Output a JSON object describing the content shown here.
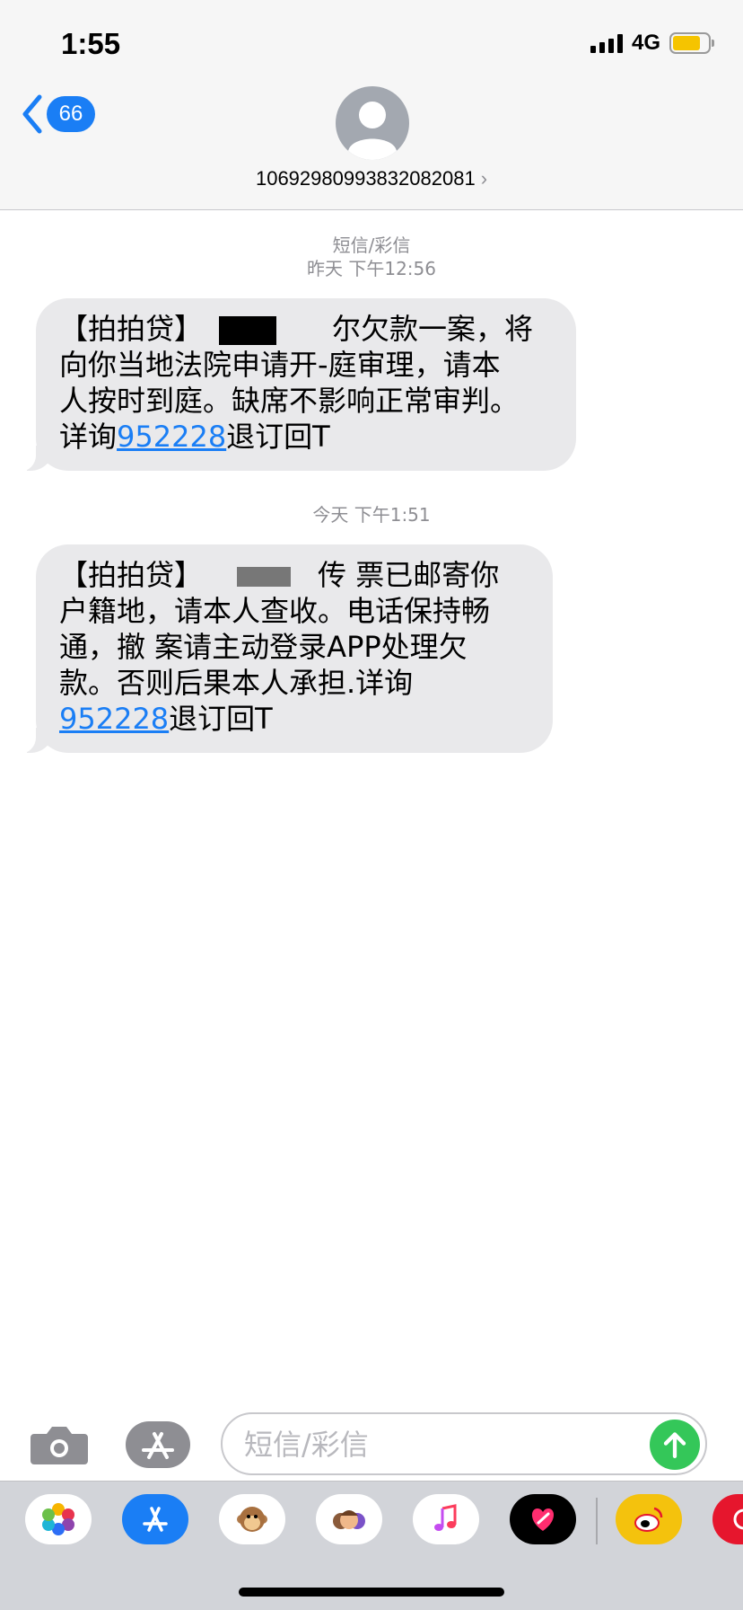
{
  "status": {
    "time": "1:55",
    "network": "4G",
    "battery_level": 0.78
  },
  "nav": {
    "back_count": "66",
    "contact": "106929809938320820​81",
    "chevron": "›"
  },
  "messages": [
    {
      "stamp_line1": "短信/彩信",
      "stamp_line2": "昨天 下午12:56",
      "l1a": "【拍拍贷】",
      "l1b": "尔欠款一案，将",
      "l2a": "向你当地法",
      "l2b": "院申请开-庭审理，请本",
      "l3": "人按时到庭。缺席不影响正常审判。",
      "l4a": "详询",
      "link": "952228",
      "l4b": "退订回T"
    },
    {
      "stamp": "今天 下午1:51",
      "l1a": "【拍拍贷】",
      "l1b": "传 票已邮寄你",
      "l2": "户籍地，请本人查收。电话保持畅",
      "l3": "通，撤 案请主动登录APP处理欠",
      "l4": "款。否则后果本人承担.详询",
      "link": "952228",
      "l5b": "退订回T"
    }
  ],
  "input": {
    "placeholder": "短信/彩信"
  },
  "drawer": {
    "apps": [
      "photos-icon",
      "app-store-icon",
      "animoji-icon",
      "memoji-icon",
      "music-icon",
      "digital-touch-icon",
      "weibo-icon",
      "partial-app-icon"
    ]
  }
}
